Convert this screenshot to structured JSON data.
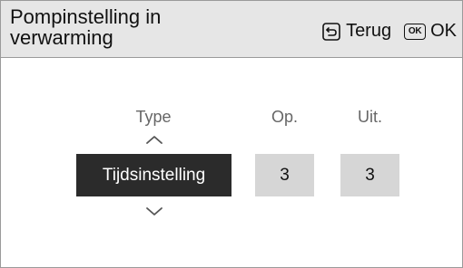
{
  "header": {
    "title_line1": "Pompinstelling in",
    "title_line2": "verwarming",
    "back_label": "Terug",
    "ok_icon_text": "OK",
    "ok_label": "OK"
  },
  "columns": {
    "type_label": "Type",
    "on_label": "Op.",
    "off_label": "Uit."
  },
  "values": {
    "type_value": "Tijdsinstelling",
    "on_value": "3",
    "off_value": "3"
  },
  "colors": {
    "header_bg": "#e6e6e6",
    "selected_bg": "#2b2b2b",
    "value_bg": "#d6d6d6",
    "label_text": "#666666"
  },
  "icons": {
    "back": "back-arrow-icon",
    "ok": "ok-key-icon",
    "up": "chevron-up-icon",
    "down": "chevron-down-icon"
  }
}
